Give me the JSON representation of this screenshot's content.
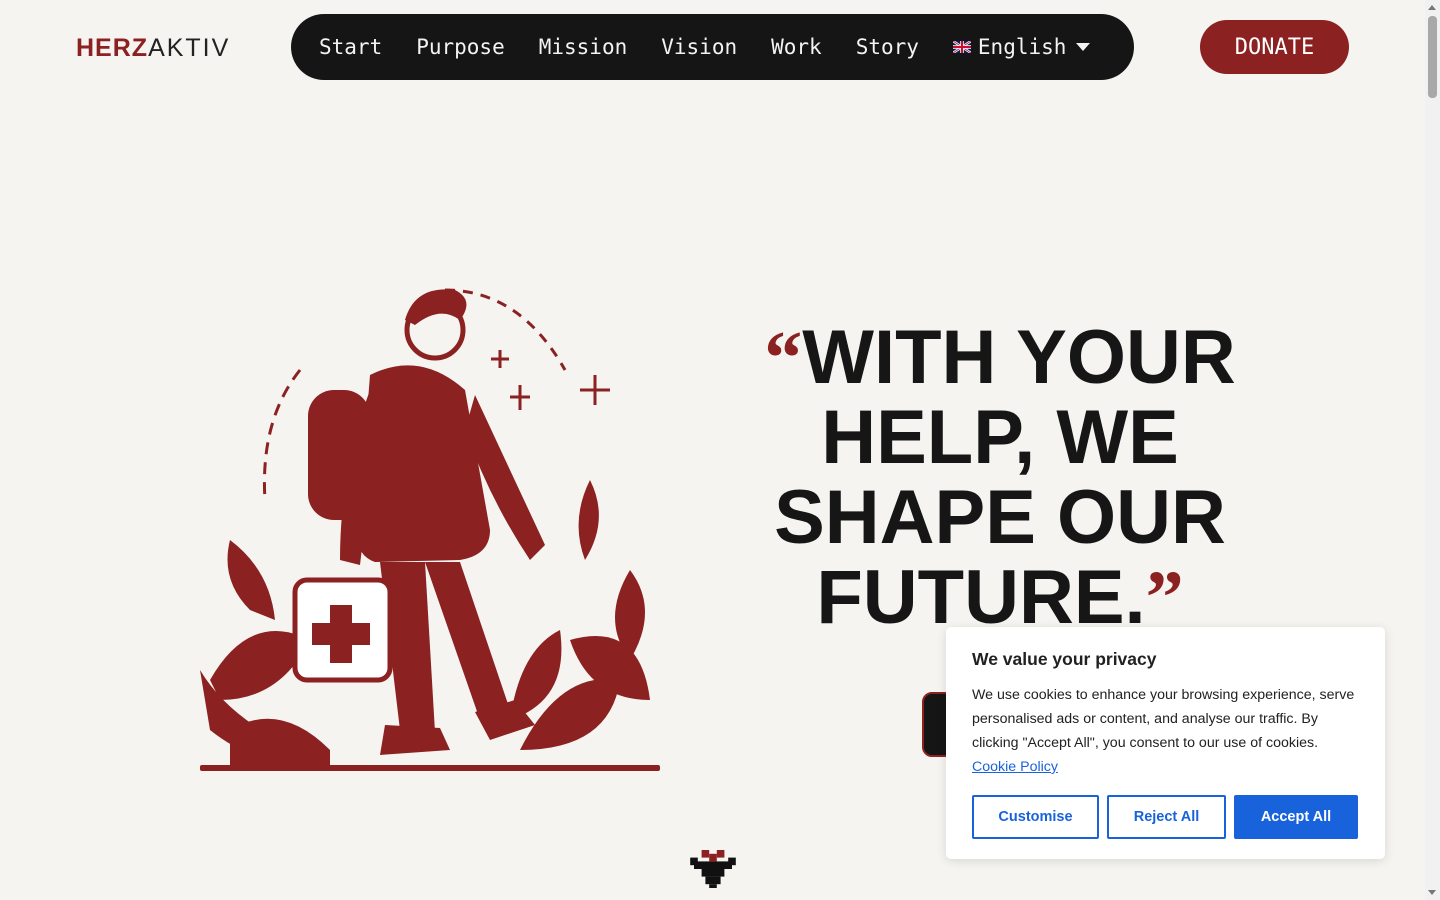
{
  "header": {
    "logo": {
      "part1": "HERZ",
      "part2": "AKTIV"
    },
    "nav": [
      {
        "label": "Start"
      },
      {
        "label": "Purpose"
      },
      {
        "label": "Mission"
      },
      {
        "label": "Vision"
      },
      {
        "label": "Work"
      },
      {
        "label": "Story"
      }
    ],
    "language": {
      "label": "English",
      "flag_icon": "uk-flag-icon"
    },
    "donate_label": "DONATE"
  },
  "hero": {
    "open_quote": "“",
    "quote_text": "WITH YOUR HELP, WE SHAPE OUR FUTURE.",
    "close_quote": "”"
  },
  "cookie_banner": {
    "title": "We value your privacy",
    "body": "We use cookies to enhance your browsing experience, serve personalised ads or content, and analyse our traffic. By clicking \"Accept All\", you consent to our use of cookies.",
    "policy_link": "Cookie Policy",
    "buttons": {
      "customise": "Customise",
      "reject": "Reject All",
      "accept": "Accept All"
    }
  },
  "colors": {
    "brand_red": "#8b2121",
    "nav_dark": "#151515",
    "background": "#f5f4f0",
    "cookie_blue": "#1863dc"
  }
}
